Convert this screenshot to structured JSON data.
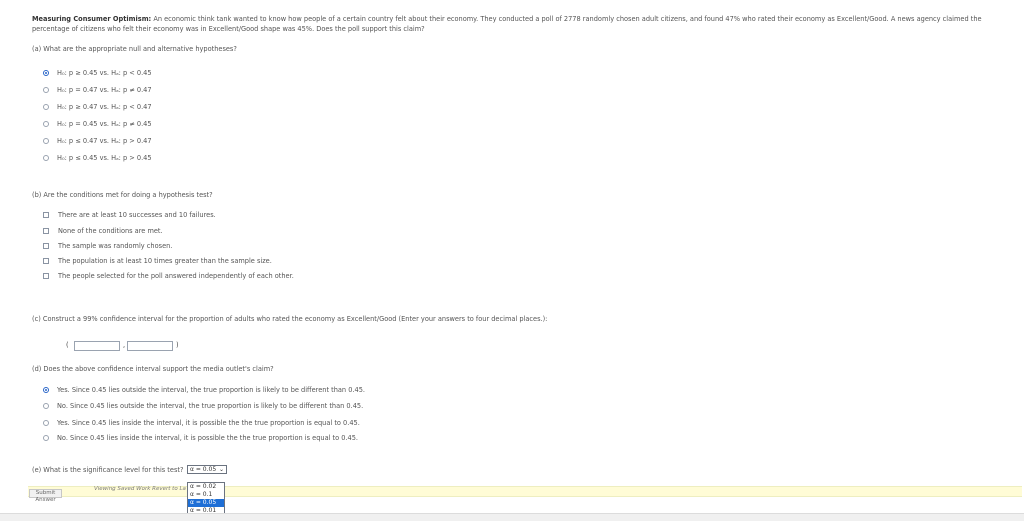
{
  "problem": {
    "title": "Measuring Consumer Optimism:",
    "text": "An economic think tank wanted to know how people of a certain country felt about their economy. They conducted a poll of 2778 randomly chosen adult citizens, and found 47% who rated their economy as Excellent/Good. A news agency claimed the percentage of citizens who felt their economy was in Excellent/Good shape was 45%. Does the poll support this claim?"
  },
  "part_a": {
    "question": "(a) What are the appropriate null and alternative hypotheses?",
    "options": [
      {
        "label": "H₀: p ≥ 0.45 vs. Hₐ: p < 0.45",
        "selected": true
      },
      {
        "label": "H₀: p = 0.47 vs. Hₐ: p ≠ 0.47",
        "selected": false
      },
      {
        "label": "H₀: p ≥ 0.47 vs. Hₐ: p < 0.47",
        "selected": false
      },
      {
        "label": "H₀: p = 0.45 vs. Hₐ: p ≠ 0.45",
        "selected": false
      },
      {
        "label": "H₀: p ≤ 0.47 vs. Hₐ: p > 0.47",
        "selected": false
      },
      {
        "label": "H₀: p ≤ 0.45 vs. Hₐ: p > 0.45",
        "selected": false
      }
    ]
  },
  "part_b": {
    "question": "(b) Are the conditions met for doing a hypothesis test?",
    "options": [
      {
        "label": "There are at least 10 successes and 10 failures."
      },
      {
        "label": "None of the conditions are met."
      },
      {
        "label": "The sample was randomly chosen."
      },
      {
        "label": "The population is at least 10 times greater than the sample size."
      },
      {
        "label": "The people selected for the poll answered independently of each other."
      }
    ]
  },
  "part_c": {
    "question": "(c) Construct a 99% confidence interval for the proportion of adults who rated the economy as Excellent/Good (Enter your answers to four decimal places.):",
    "open_paren": "(",
    "comma": ",",
    "close_paren": ")",
    "lower_value": "",
    "upper_value": ""
  },
  "part_d": {
    "question": "(d) Does the above confidence interval support the media outlet's claim?",
    "options": [
      {
        "label": "Yes. Since 0.45 lies outside the interval, the true proportion is likely to be different than 0.45.",
        "selected": true
      },
      {
        "label": "No. Since 0.45 lies outside the interval, the true proportion is likely to be different than 0.45.",
        "selected": false
      },
      {
        "label": "Yes. Since 0.45 lies inside the interval, it is possible the the true proportion is equal to 0.45.",
        "selected": false
      },
      {
        "label": "No. Since 0.45 lies inside the interval, it is possible the the true proportion is equal to 0.45.",
        "selected": false
      }
    ]
  },
  "part_e": {
    "question": "(e) What is the significance level for this test?",
    "selected": "α = 0.05",
    "dropdown_options": [
      "α = 0.02",
      "α = 0.1",
      "α = 0.05",
      "α = 0.01"
    ],
    "highlighted_index": 2
  },
  "footer": {
    "submit_label": "Submit Answer",
    "status_text": "Viewing Saved Work Revert to La"
  },
  "colors": {
    "accent": "#2a66c9",
    "highlight": "#1e6fd6",
    "footer_bg": "#fffcd6"
  }
}
